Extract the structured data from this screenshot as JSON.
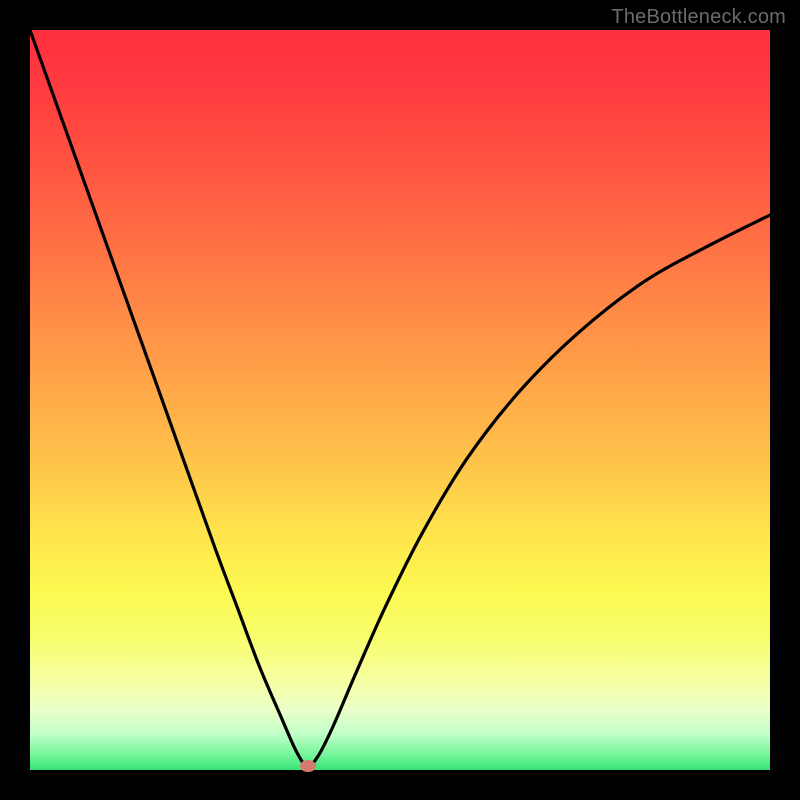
{
  "watermark_text": "TheBottleneck.com",
  "colors": {
    "frame_bg": "#000000",
    "curve_stroke": "#000000",
    "marker_fill": "#d6796f",
    "gradient_stops": [
      "#ff2f3e",
      "#ff3b40",
      "#ff5442",
      "#ff6e44",
      "#ff8a46",
      "#ffa648",
      "#ffc24a",
      "#ffe44c",
      "#fcf951",
      "#f8fe6c",
      "#f5ffa2",
      "#e8ffc8",
      "#c4ffca",
      "#74f598",
      "#36e277"
    ]
  },
  "chart_data": {
    "type": "line",
    "title": "",
    "xlabel": "",
    "ylabel": "",
    "xlim": [
      0,
      100
    ],
    "ylim": [
      0,
      100
    ],
    "x": [
      0,
      5,
      10,
      15,
      20,
      25,
      28,
      31,
      34,
      36,
      37.5,
      39,
      41,
      44,
      48,
      53,
      59,
      66,
      74,
      83,
      92,
      100
    ],
    "values": [
      100,
      86,
      72,
      58,
      44,
      30,
      22,
      14,
      7,
      2.5,
      0.5,
      2,
      6,
      13,
      22,
      32,
      42,
      51,
      59,
      66,
      71,
      75
    ],
    "minimum_marker": {
      "x": 37.5,
      "y": 0.5
    },
    "annotations": [
      "TheBottleneck.com"
    ]
  }
}
